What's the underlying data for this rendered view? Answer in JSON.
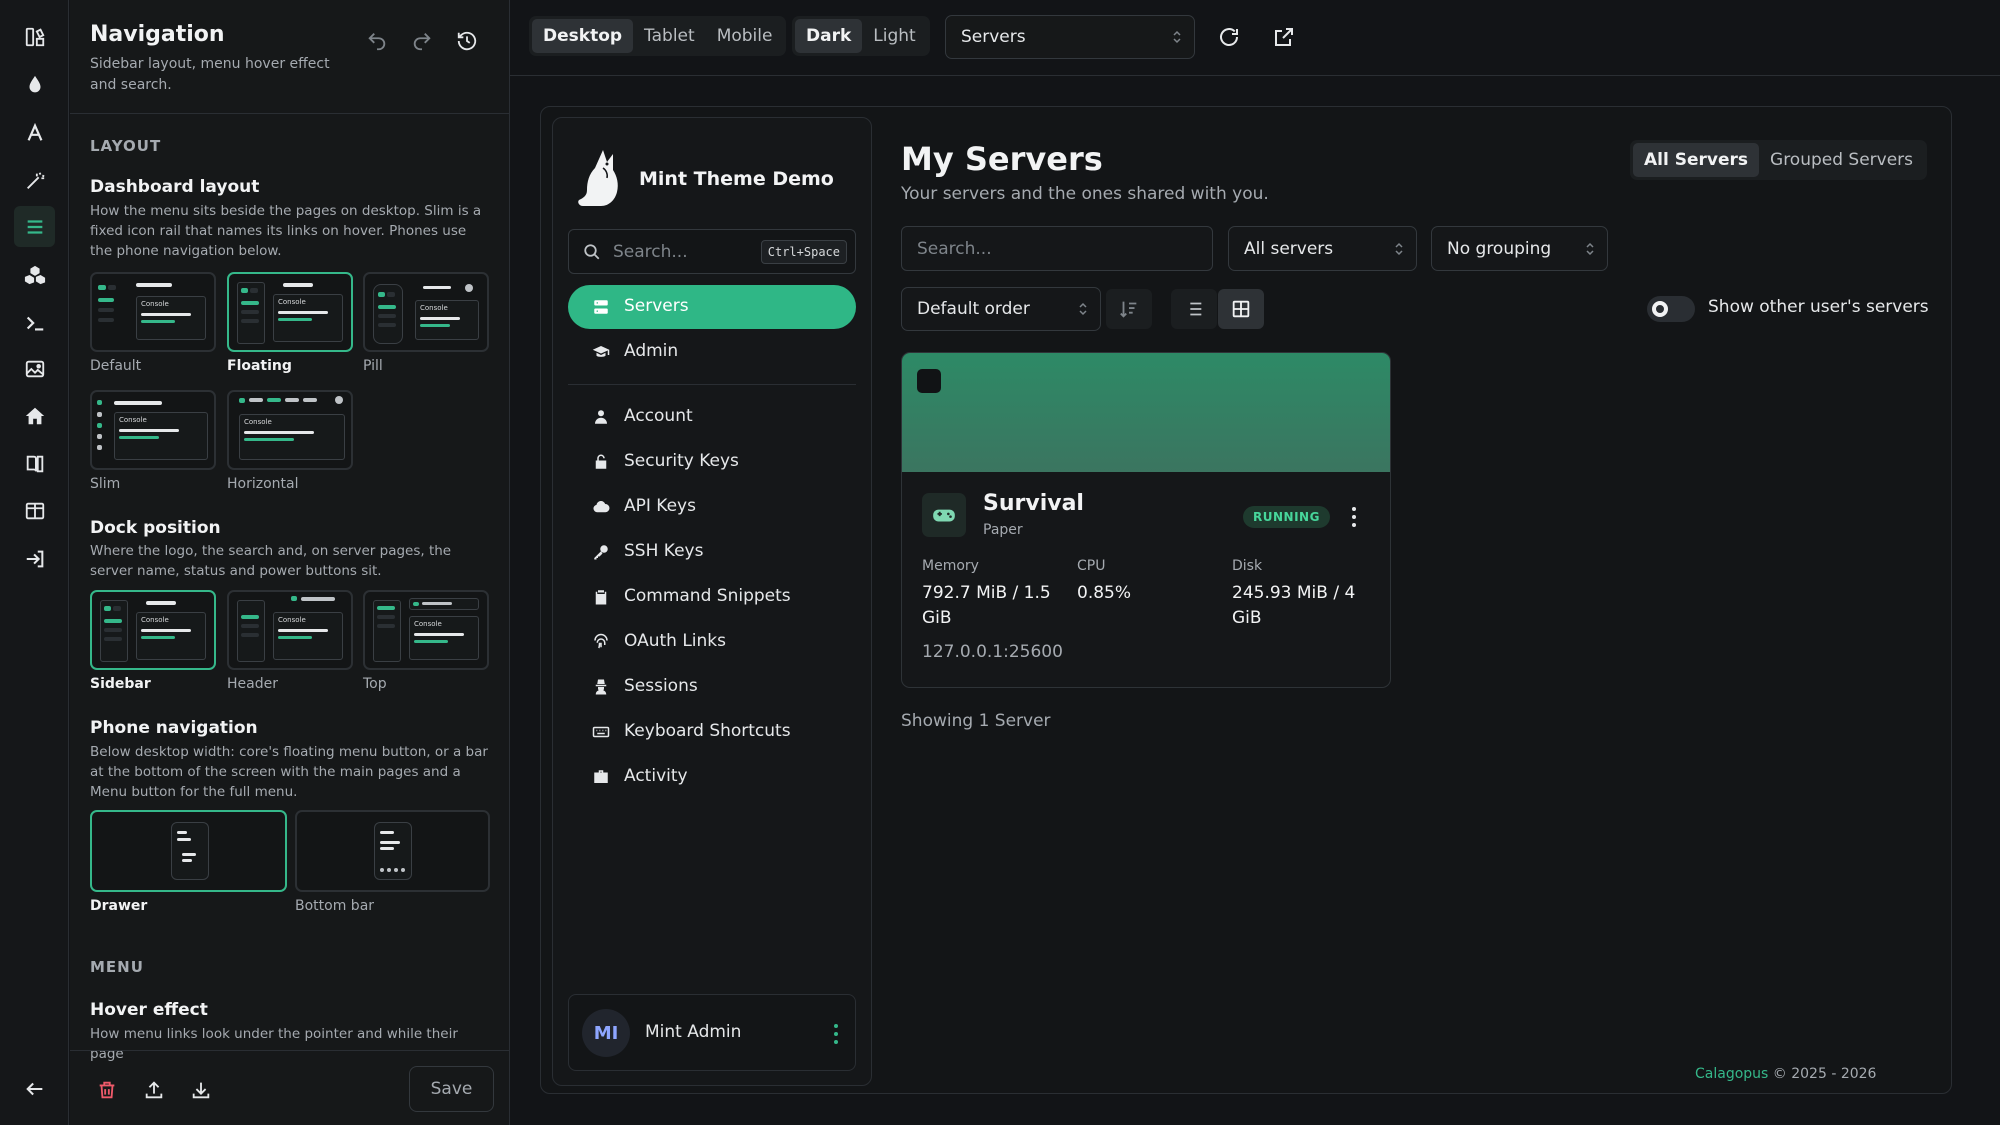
{
  "rail": {
    "active": "menu-icon"
  },
  "panel": {
    "title": "Navigation",
    "subtitle": "Sidebar layout, menu hover effect and search.",
    "layout_section": "LAYOUT",
    "dashboard_layout": {
      "title": "Dashboard layout",
      "desc": "How the menu sits beside the pages on desktop. Slim is a fixed icon rail that names its links on hover. Phones use the phone navigation below.",
      "options": [
        "Default",
        "Floating",
        "Pill",
        "Slim",
        "Horizontal"
      ],
      "selected": "Floating",
      "thumb_text": "Console"
    },
    "dock_position": {
      "title": "Dock position",
      "desc": "Where the logo, the search and, on server pages, the server name, status and power buttons sit.",
      "options": [
        "Sidebar",
        "Header",
        "Top"
      ],
      "selected": "Sidebar"
    },
    "phone_navigation": {
      "title": "Phone navigation",
      "desc": "Below desktop width: core's floating menu button, or a bar at the bottom of the screen with the main pages and a Menu button for the full menu.",
      "options": [
        "Drawer",
        "Bottom bar"
      ],
      "selected": "Drawer"
    },
    "menu_section": "MENU",
    "hover_effect": {
      "title": "Hover effect",
      "desc": "How menu links look under the pointer and while their page"
    },
    "save_label": "Save"
  },
  "topbar": {
    "devices": [
      "Desktop",
      "Tablet",
      "Mobile"
    ],
    "device_selected": "Desktop",
    "themes": [
      "Dark",
      "Light"
    ],
    "theme_selected": "Dark",
    "page_select": "Servers"
  },
  "sidebar": {
    "brand": "Mint Theme Demo",
    "search_placeholder": "Search...",
    "search_shortcut": "Ctrl+Space",
    "nav_top": [
      {
        "label": "Servers",
        "icon": "server-icon",
        "active": true
      },
      {
        "label": "Admin",
        "icon": "graduation-cap-icon"
      }
    ],
    "nav_account": [
      {
        "label": "Account",
        "icon": "user-icon"
      },
      {
        "label": "Security Keys",
        "icon": "lock-icon"
      },
      {
        "label": "API Keys",
        "icon": "cloud-icon"
      },
      {
        "label": "SSH Keys",
        "icon": "key-icon"
      },
      {
        "label": "Command Snippets",
        "icon": "clipboard-icon"
      },
      {
        "label": "OAuth Links",
        "icon": "fingerprint-icon"
      },
      {
        "label": "Sessions",
        "icon": "user-secret-icon"
      },
      {
        "label": "Keyboard Shortcuts",
        "icon": "keyboard-icon"
      },
      {
        "label": "Activity",
        "icon": "briefcase-icon"
      }
    ],
    "user": {
      "initials": "MI",
      "name": "Mint Admin"
    }
  },
  "main": {
    "title": "My Servers",
    "subtitle": "Your servers and the ones shared with you.",
    "view_tabs": [
      "All Servers",
      "Grouped Servers"
    ],
    "view_selected": "All Servers",
    "search_placeholder": "Search...",
    "filter": "All servers",
    "grouping": "No grouping",
    "order": "Default order",
    "show_others_label": "Show other user's servers",
    "card": {
      "name": "Survival",
      "type": "Paper",
      "status": "RUNNING",
      "memory_label": "Memory",
      "memory_value": "792.7 MiB / 1.5 GiB",
      "cpu_label": "CPU",
      "cpu_value": "0.85%",
      "disk_label": "Disk",
      "disk_value": "245.93 MiB / 4 GiB",
      "address": "127.0.0.1:25600"
    },
    "showing": "Showing 1 Server",
    "footer_link": "Calagopus",
    "footer_text": "© 2025 - 2026"
  },
  "colors": {
    "accent": "#2fb786",
    "background": "#121417",
    "running_badge": "#47d69b"
  }
}
